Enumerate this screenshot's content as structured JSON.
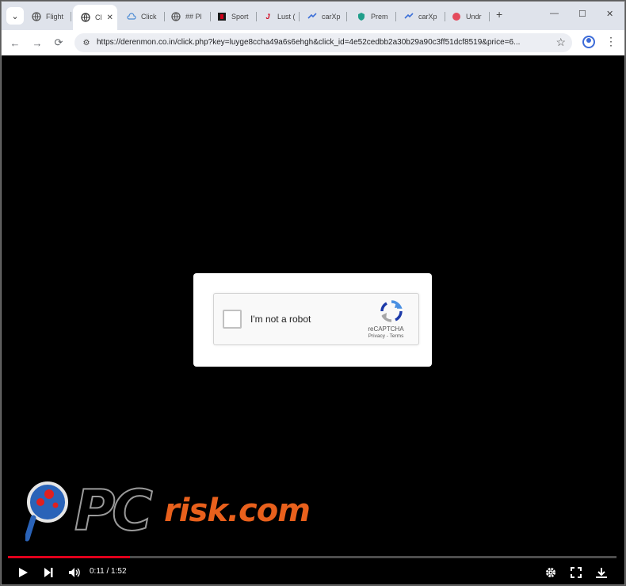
{
  "browser": {
    "tabs": [
      {
        "label": "Flight",
        "icon": "globe-icon"
      },
      {
        "label": "Cl",
        "icon": "globe-icon",
        "active": true
      },
      {
        "label": "Click",
        "icon": "cloud-icon"
      },
      {
        "label": "## Pl",
        "icon": "globe-icon"
      },
      {
        "label": "Sport",
        "icon": "sport-icon"
      },
      {
        "label": "Lust (",
        "icon": "lust-icon"
      },
      {
        "label": "carXp",
        "icon": "carxp-icon"
      },
      {
        "label": "Prem",
        "icon": "shield-icon"
      },
      {
        "label": "carXp",
        "icon": "carxp-icon"
      },
      {
        "label": "Undr",
        "icon": "red-circle-icon"
      }
    ],
    "url": "https://derenmon.co.in/click.php?key=luyge8ccha49a6s6ehgh&click_id=4e52cedbb2a30b29a90c3ff51dcf8519&price=6..."
  },
  "captcha": {
    "label": "I'm not a robot",
    "brand": "reCAPTCHA",
    "links": "Privacy - Terms"
  },
  "watermark": {
    "pc": "PC",
    "text": "risk.com"
  },
  "video": {
    "current_time": "0:11",
    "duration": "1:52",
    "time_display": "0:11 / 1:52",
    "progress": 0.2
  },
  "colors": {
    "progress": "#e0001b",
    "watermark_orange": "#e8601c"
  }
}
